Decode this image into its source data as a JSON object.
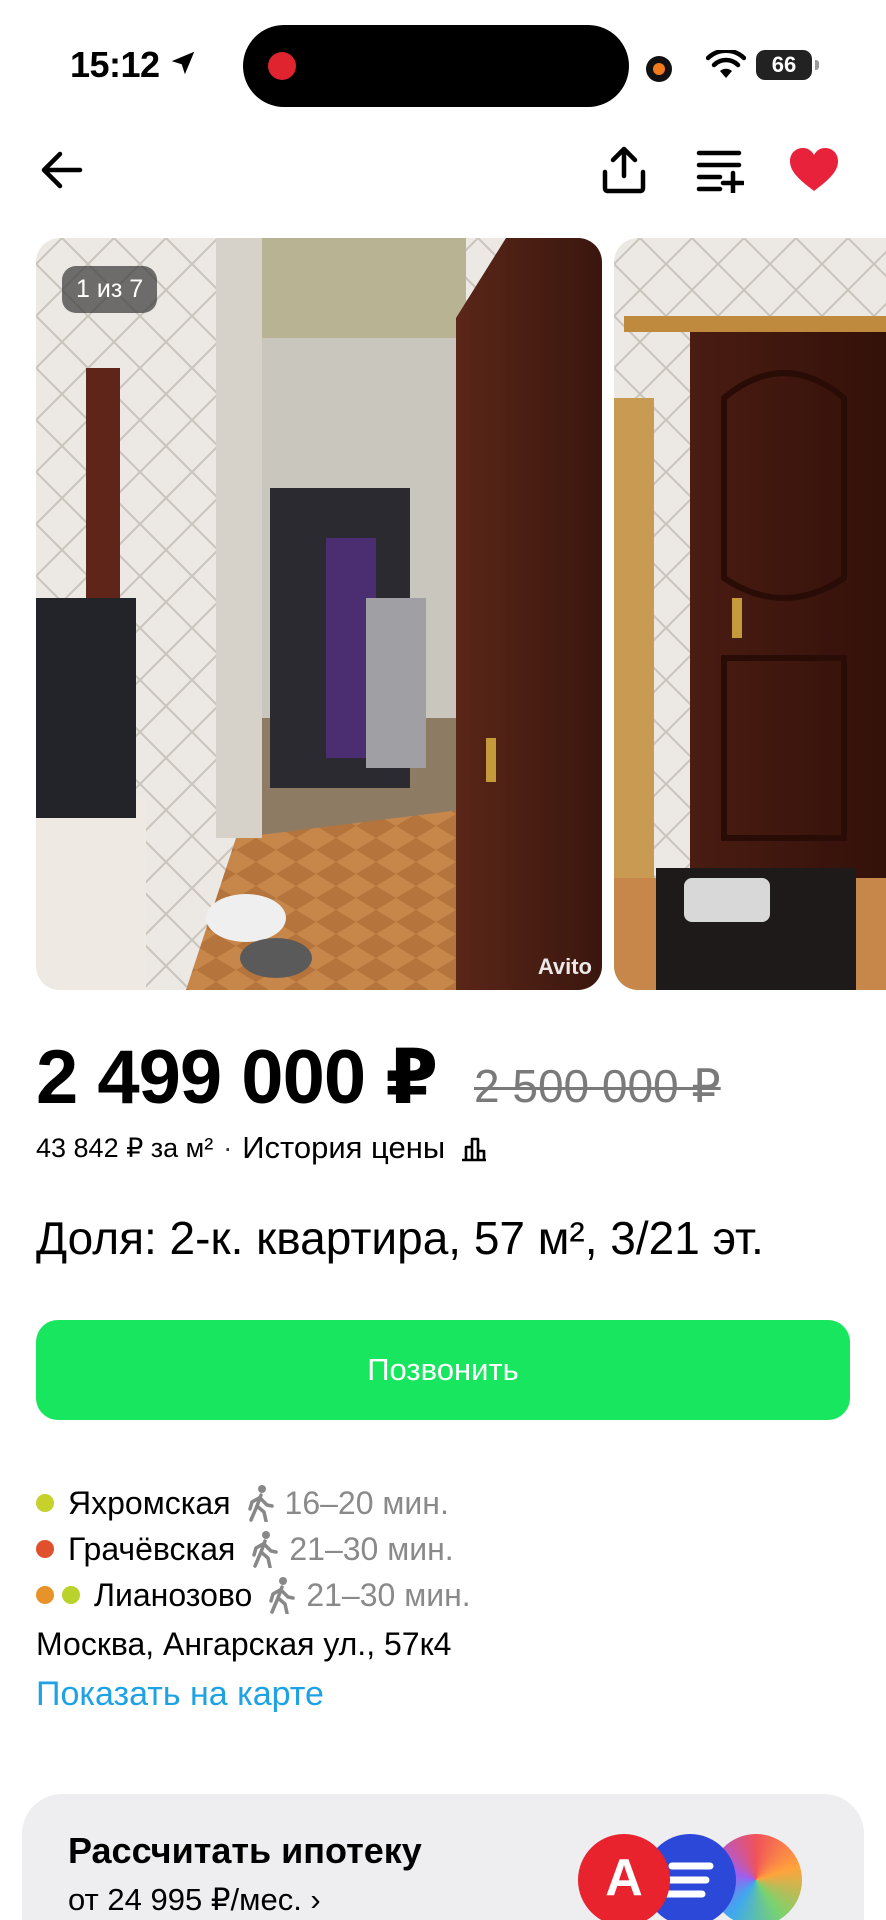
{
  "status_bar": {
    "time": "15:12",
    "battery": "66"
  },
  "nav": {
    "back_icon": "arrow-left-icon",
    "share_icon": "share-icon",
    "compare_icon": "compare-list-icon",
    "favorite_icon": "heart-filled-icon"
  },
  "gallery": {
    "counter": "1 из 7",
    "watermark": "Avito"
  },
  "listing": {
    "price": "2 499 000 ₽",
    "old_price": "2 500 000 ₽",
    "price_per_m2": "43 842 ₽ за м²",
    "separator": "·",
    "price_history": "История цены",
    "title": "Доля: 2-к. квартира, 57 м², 3/21 эт."
  },
  "call_button": "Позвонить",
  "metro": [
    {
      "name": "Яхромская",
      "time": "16–20 мин.",
      "colors": [
        "#c6d12c"
      ]
    },
    {
      "name": "Грачёвская",
      "time": "21–30 мин.",
      "colors": [
        "#e0502c"
      ]
    },
    {
      "name": "Лианозово",
      "time": "21–30 мин.",
      "colors": [
        "#e8922a",
        "#b9d22c"
      ]
    }
  ],
  "address": "Москва, Ангарская ул., 57к4",
  "map_link": "Показать на карте",
  "mortgage": {
    "title": "Рассчитать ипотеку",
    "subtitle": "от 24 995 ₽/мес. ›",
    "bank_1_letter": "А"
  },
  "colors": {
    "call_button": "#17e65e",
    "link": "#1fa2e3",
    "favorite": "#e8223a"
  }
}
